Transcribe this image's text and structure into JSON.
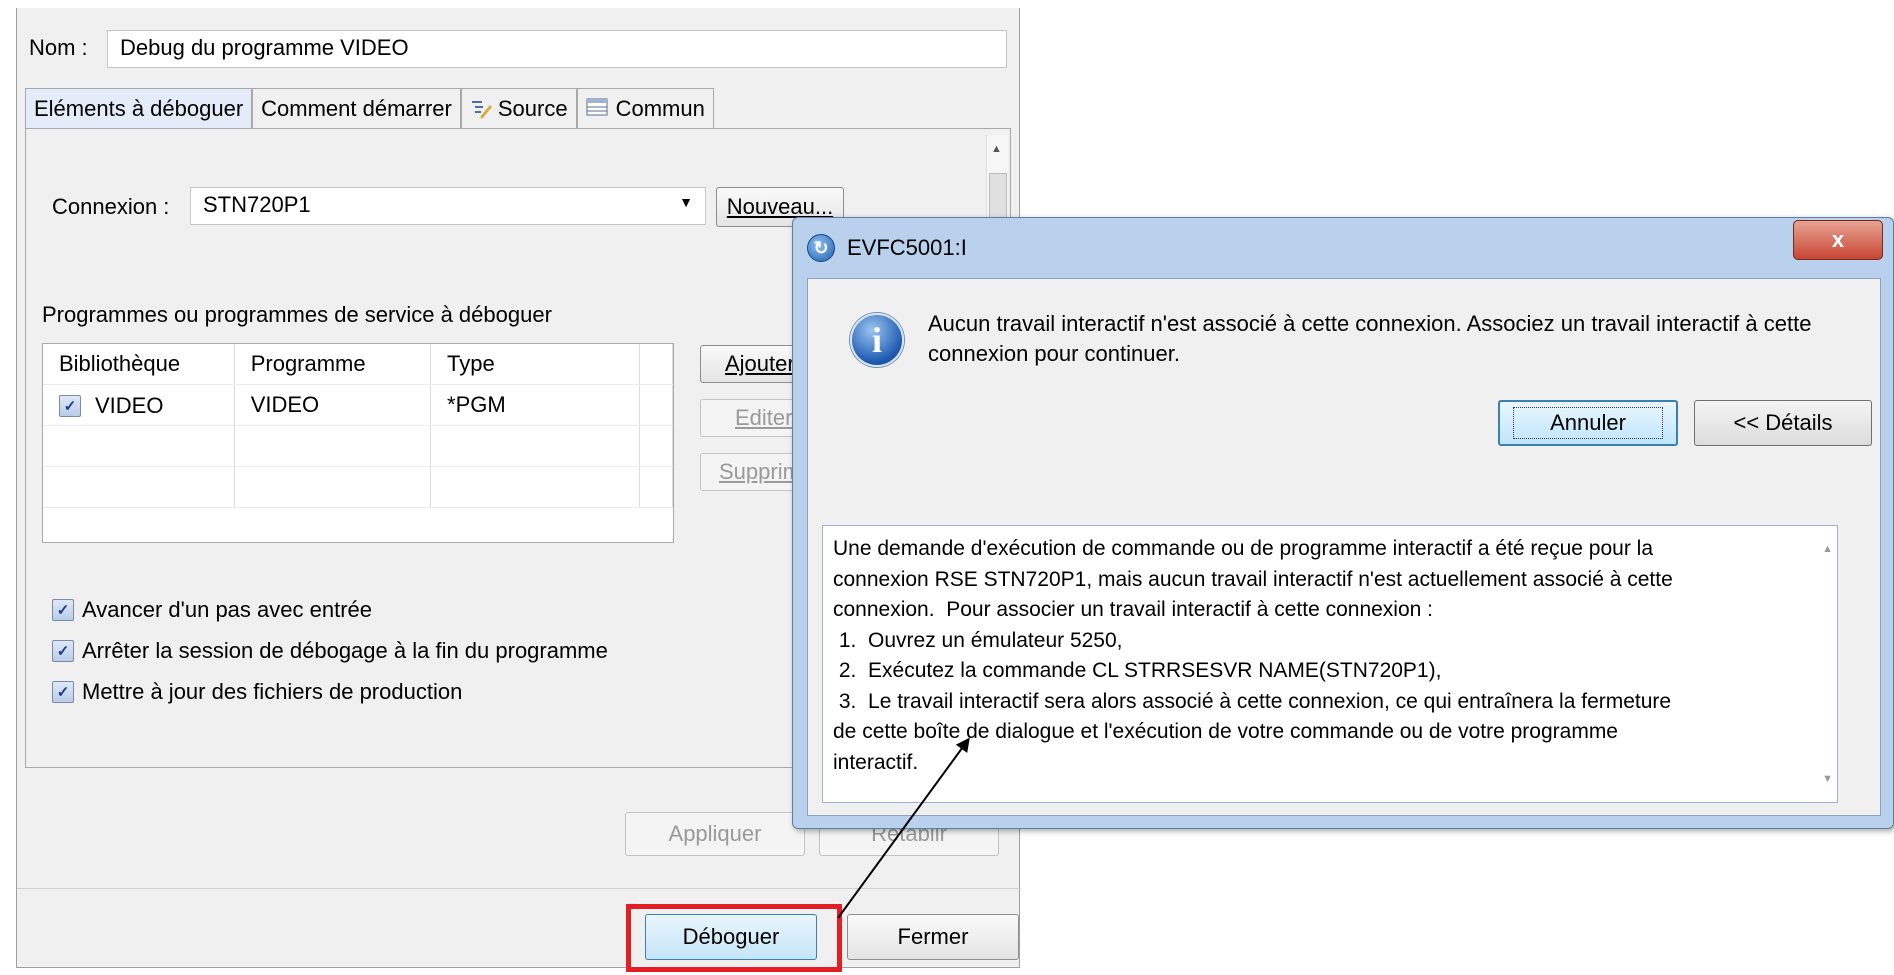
{
  "main": {
    "name_label": "Nom :",
    "name_value": "Debug du programme VIDEO",
    "tabs": [
      {
        "label": "Eléments à déboguer",
        "active": true
      },
      {
        "label": "Comment démarrer",
        "active": false
      },
      {
        "label": "Source",
        "active": false
      },
      {
        "label": "Commun",
        "active": false
      }
    ],
    "connexion_label": "Connexion :",
    "connexion_value": "STN720P1",
    "nouveau_button": "Nouveau...",
    "programs_label": "Programmes ou programmes de service à déboguer",
    "table": {
      "columns": [
        "Bibliothèque",
        "Programme",
        "Type"
      ],
      "rows": [
        {
          "checked": true,
          "library": "VIDEO",
          "program": "VIDEO",
          "type": "*PGM"
        }
      ]
    },
    "side_buttons": {
      "add": "Ajouter",
      "edit": "Editer.",
      "remove": "Supprim"
    },
    "checkboxes": [
      {
        "label": "Avancer d'un pas avec entrée",
        "checked": true
      },
      {
        "label": "Arrêter la session de débogage à la fin du programme",
        "checked": true
      },
      {
        "label": "Mettre à jour des fichiers de production",
        "checked": true
      }
    ],
    "apply_button": "Appliquer",
    "restore_button": "Rétablir",
    "debug_button": "Déboguer",
    "close_button": "Fermer"
  },
  "popup": {
    "title": "EVFC5001:I",
    "close_glyph": "x",
    "message": "Aucun travail interactif n'est associé à cette connexion.  Associez un travail interactif à cette connexion pour continuer.",
    "cancel_button": "Annuler",
    "details_button": "<< Détails",
    "details_lines": [
      "Une demande d'exécution de commande ou de programme interactif a été reçue pour la",
      "connexion RSE STN720P1, mais aucun travail interactif n'est actuellement associé à cette",
      "connexion.  Pour associer un travail interactif à cette connexion :",
      " 1.  Ouvrez un émulateur 5250,",
      " 2.  Exécutez la commande CL STRRSESVR NAME(STN720P1),",
      " 3.  Le travail interactif sera alors associé à cette connexion, ce qui entraînera la fermeture",
      "de cette boîte de dialogue et l'exécution de votre commande ou de votre programme",
      "interactif."
    ]
  },
  "annotation": {
    "highlight_color": "#e31e24",
    "arrow_color": "#000000"
  }
}
